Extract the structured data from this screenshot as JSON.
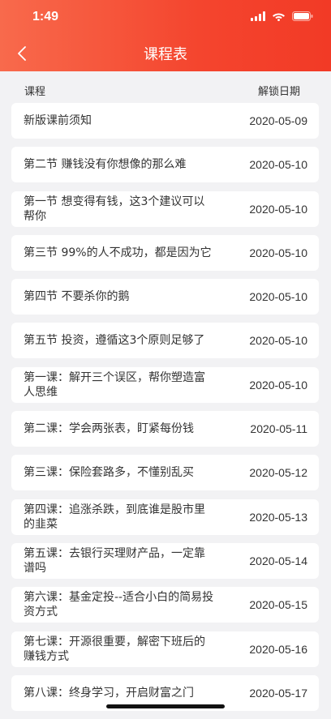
{
  "status_bar": {
    "time": "1:49"
  },
  "nav": {
    "title": "课程表"
  },
  "columns": {
    "course": "课程",
    "unlock_date": "解锁日期"
  },
  "courses": [
    {
      "title": "新版课前须知",
      "date": "2020-05-09"
    },
    {
      "title": "第二节 赚钱没有你想像的那么难",
      "date": "2020-05-10"
    },
    {
      "title": "第一节 想变得有钱，这3个建议可以帮你",
      "date": "2020-05-10"
    },
    {
      "title": "第三节 99%的人不成功，都是因为它",
      "date": "2020-05-10"
    },
    {
      "title": "第四节 不要杀你的鹅",
      "date": "2020-05-10"
    },
    {
      "title": "第五节 投资，遵循这3个原则足够了",
      "date": "2020-05-10"
    },
    {
      "title": "第一课：解开三个误区，帮你塑造富人思维",
      "date": "2020-05-10"
    },
    {
      "title": "第二课：学会两张表，盯紧每份钱",
      "date": "2020-05-11"
    },
    {
      "title": "第三课：保险套路多，不懂别乱买",
      "date": "2020-05-12"
    },
    {
      "title": "第四课：追涨杀跌，到底谁是股市里的韭菜",
      "date": "2020-05-13"
    },
    {
      "title": "第五课：去银行买理财产品，一定靠谱吗",
      "date": "2020-05-14"
    },
    {
      "title": "第六课：基金定投--适合小白的简易投资方式",
      "date": "2020-05-15"
    },
    {
      "title": "第七课：开源很重要，解密下班后的赚钱方式",
      "date": "2020-05-16"
    },
    {
      "title": "第八课：终身学习，开启财富之门",
      "date": "2020-05-17"
    }
  ],
  "colors": {
    "header_start": "#f86a4c",
    "header_end": "#f23a26",
    "background": "#f2f2f4"
  },
  "icons": [
    "signal-icon",
    "wifi-icon",
    "battery-icon",
    "back-arrow-icon"
  ]
}
